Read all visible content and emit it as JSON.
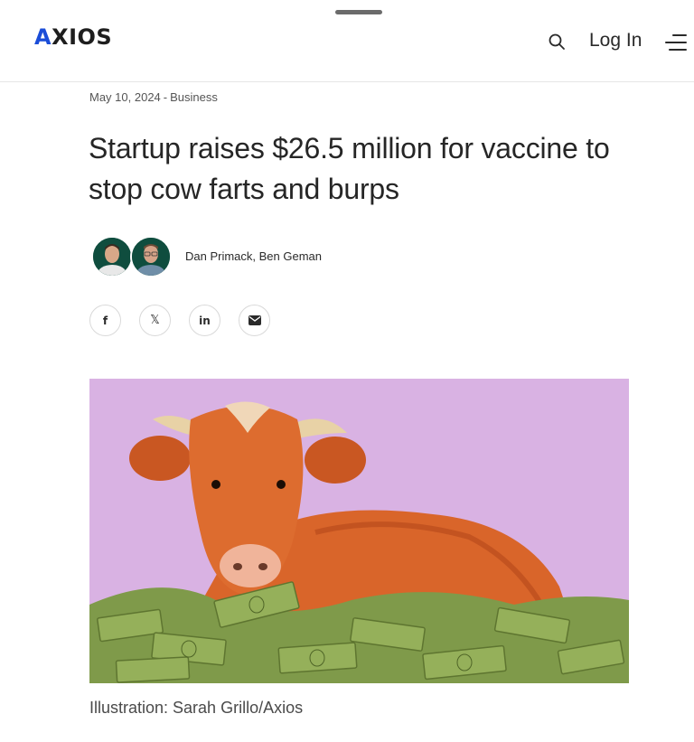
{
  "header": {
    "logo_first": "A",
    "logo_rest": "XIOS",
    "login_label": "Log In",
    "search_icon": "search-icon",
    "menu_icon": "menu-icon",
    "brand_color": "#1b4dd8"
  },
  "article": {
    "date": "May 10, 2024",
    "separator": "-",
    "section": "Business",
    "headline": "Startup raises $26.5 million for vaccine to stop cow farts and burps",
    "authors": "Dan Primack, Ben Geman",
    "share": {
      "facebook": "f",
      "x": "𝕏",
      "linkedin": "in",
      "email_icon": "mail-icon"
    },
    "image_caption": "Illustration: Sarah Grillo/Axios"
  },
  "colors": {
    "hero_background": "#d9b2e3",
    "cow": "#d9652a",
    "money": "#7f9a4a",
    "avatar_bg": "#0f4d3e"
  }
}
